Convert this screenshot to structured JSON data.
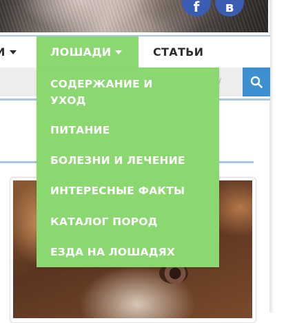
{
  "header": {
    "social": [
      {
        "name": "facebook-icon",
        "glyph": "f"
      },
      {
        "name": "vk-icon",
        "glyph": "в"
      }
    ]
  },
  "nav": {
    "items": [
      {
        "label": "И",
        "has_caret": true
      },
      {
        "label": "ЛОШАДИ",
        "has_caret": true,
        "active": true
      },
      {
        "label": "СТАТЬИ",
        "has_caret": false
      }
    ]
  },
  "search": {
    "hint": "/",
    "button_icon": "search-icon"
  },
  "dropdown": {
    "items": [
      {
        "line1": "СОДЕРЖАНИЕ И",
        "line2": "УХОД"
      },
      {
        "line1": "ПИТАНИЕ"
      },
      {
        "line1": "БОЛЕЗНИ И ЛЕЧЕНИЕ"
      },
      {
        "line1": "ИНТЕРЕСНЫЕ ФАКТЫ"
      },
      {
        "line1": "КАТАЛОГ ПОРОД"
      },
      {
        "line1": "ЕЗДА НА ЛОШАДЯХ"
      }
    ]
  },
  "colors": {
    "menu_green": "#8cd870",
    "search_blue": "#3d8fcf",
    "divider_blue": "#a8c8e0",
    "social_blue": "#3b5cb3"
  }
}
